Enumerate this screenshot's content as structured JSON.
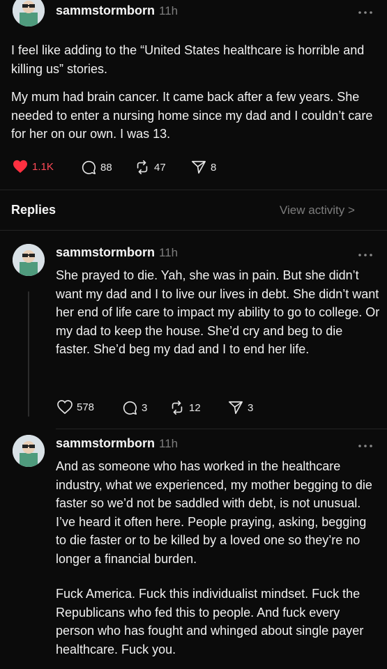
{
  "main_post": {
    "username": "sammstormborn",
    "time": "11h",
    "paragraphs": [
      "I feel like adding to the “United States healthcare is horrible and killing us” stories.",
      "My mum had brain cancer. It came back after a few years. She needed to enter a nursing home since my dad and I couldn’t care for her on our own. I was 13."
    ],
    "likes": "1.1K",
    "replies": "88",
    "reposts": "47",
    "shares": "8"
  },
  "replies_header": {
    "title": "Replies",
    "view_activity": "View activity >"
  },
  "reply1": {
    "username": "sammstormborn",
    "time": "11h",
    "paragraphs": [
      "She prayed to die. Yah, she was in pain. But she didn’t want my dad and I to live our lives in debt. She didn’t want her end of life care to impact my ability to go to college. Or my dad to keep the house. She’d cry and beg to die faster. She’d beg my dad and I to end her life."
    ],
    "likes": "578",
    "replies": "3",
    "reposts": "12",
    "shares": "3"
  },
  "reply2": {
    "username": "sammstormborn",
    "time": "11h",
    "paragraphs": [
      "And as someone who has worked in the healthcare industry, what we experienced, my mother begging to die faster so we’d not be saddled with debt, is not unusual. I’ve heard it often here. People praying, asking, begging to die faster or to be killed by a loved one so they’re no longer a financial burden.",
      "Fuck America. Fuck this individualist mindset. Fuck the Republicans who fed this to people. And fuck every person who has fought and whinged about single payer healthcare. Fuck you."
    ]
  },
  "colors": {
    "background": "#0b0b0b",
    "like_red": "#ff3040",
    "muted": "#7d7d7d"
  },
  "icons": [
    "heart-icon",
    "comment-icon",
    "repost-icon",
    "share-icon",
    "more-icon",
    "avatar"
  ]
}
